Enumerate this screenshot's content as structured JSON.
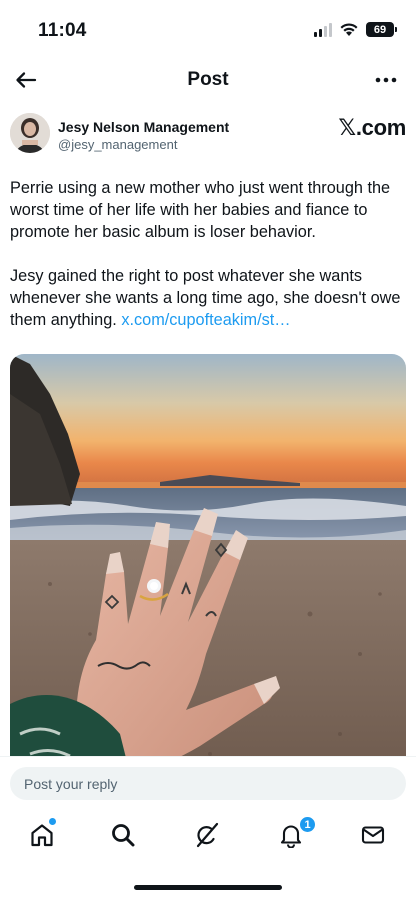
{
  "status_bar": {
    "time": "11:04",
    "battery": "69",
    "icons": [
      "cellular-signal-icon",
      "wifi-icon",
      "battery-icon"
    ]
  },
  "header": {
    "title": "Post",
    "back_icon": "arrow-left-icon",
    "more_icon": "more-horizontal-icon"
  },
  "post": {
    "author_name": "Jesy Nelson Management",
    "author_handle": "@jesy_management",
    "source": "𝕏.com",
    "paragraphs": [
      "Perrie using a new mother who just went through the worst time of her life with her babies and fiance to promote her basic album is loser behavior.",
      "Jesy gained the right to post whatever she wants whenever she wants a long time ago, she doesn't owe them anything."
    ],
    "link": "x.com/cupofteakim/st…",
    "media_description_icon": "photo"
  },
  "reply": {
    "placeholder": "Post your reply"
  },
  "tabbar": {
    "items": [
      "home-icon",
      "search-icon",
      "grok-icon",
      "notifications-icon",
      "messages-icon"
    ],
    "notification_count": "1"
  },
  "colors": {
    "accent": "#1d9bf0",
    "text": "#0f1419",
    "secondary": "#536471"
  }
}
